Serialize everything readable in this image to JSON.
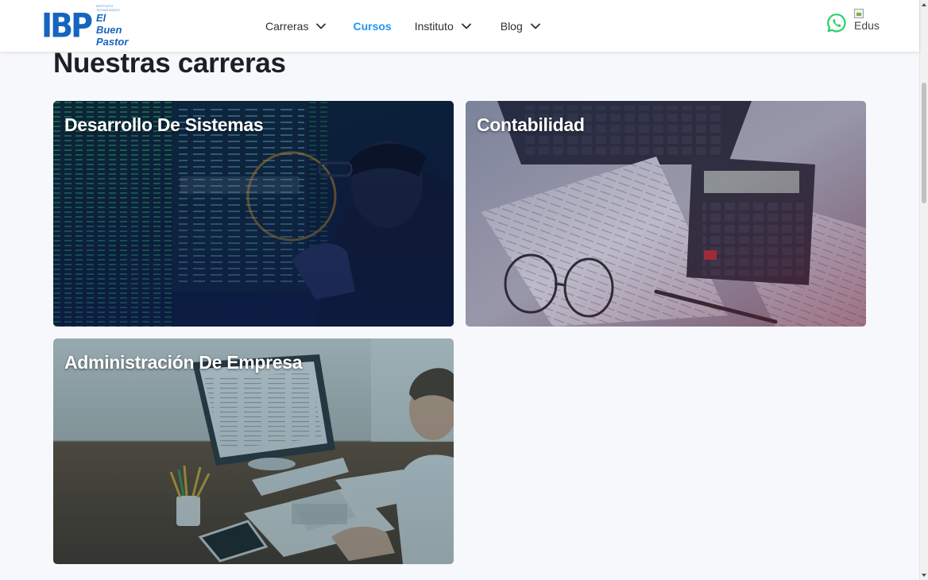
{
  "header": {
    "logo": {
      "mark": "IBP",
      "line1": "El Buen",
      "line2": "Pastor",
      "small": "INSTITUTO TECNOLÓGICO"
    },
    "nav": [
      {
        "label": "Carreras",
        "has_dropdown": true
      },
      {
        "label": "Cursos",
        "has_dropdown": false,
        "active": true
      },
      {
        "label": "Instituto",
        "has_dropdown": true
      },
      {
        "label": "Blog",
        "has_dropdown": true
      }
    ],
    "whatsapp_icon": "whatsapp-icon",
    "broken_image_alt": "Edus"
  },
  "main": {
    "section_title": "Nuestras carreras",
    "cards": [
      {
        "title": "Desarrollo De Sistemas"
      },
      {
        "title": "Contabilidad"
      },
      {
        "title": "Administración De Empresa"
      }
    ]
  },
  "colors": {
    "accent": "#2196f3",
    "brand": "#1565c0",
    "whatsapp": "#25d366"
  }
}
